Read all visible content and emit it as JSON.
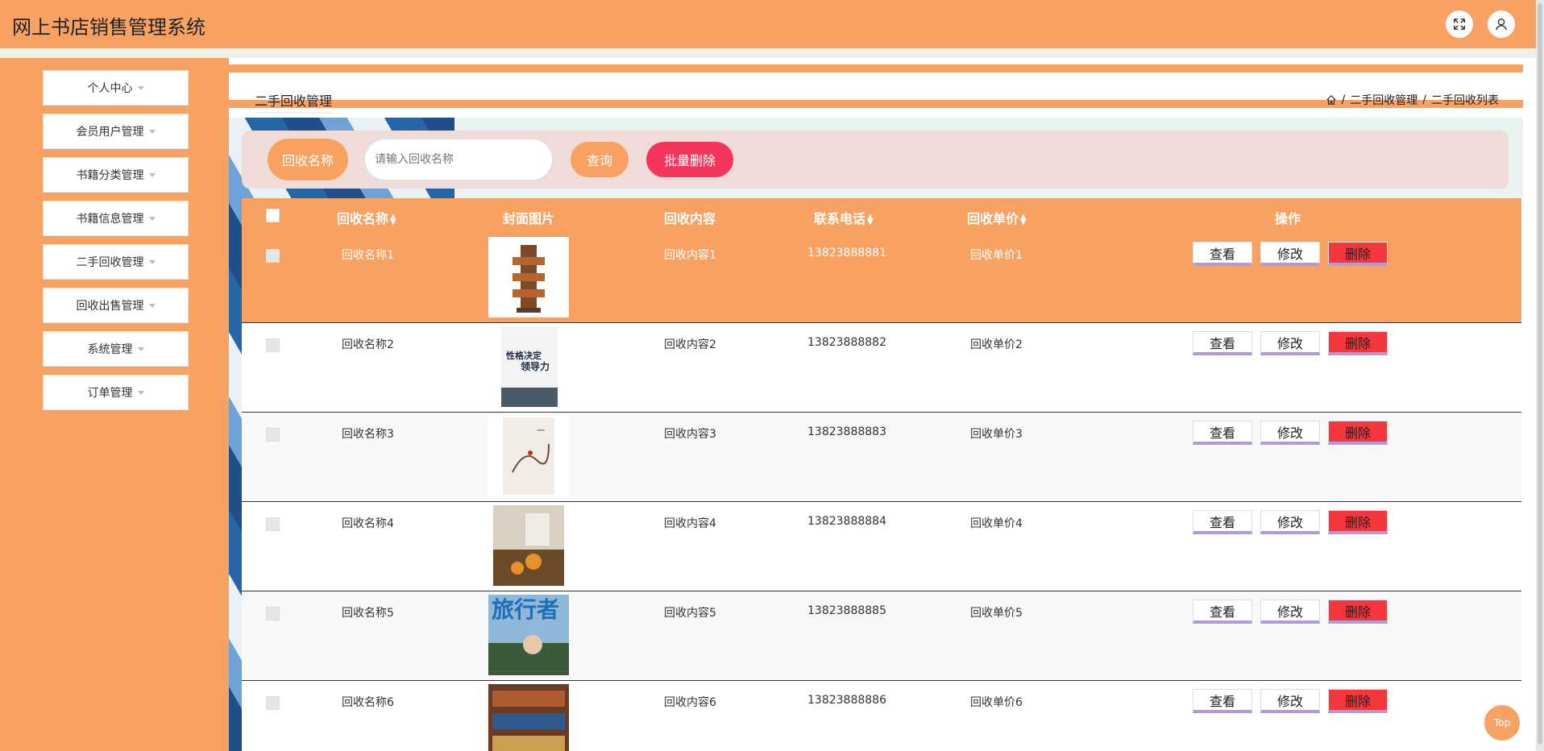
{
  "header": {
    "title": "网上书店销售管理系统",
    "fullscreen_icon": "fullscreen-icon",
    "user_icon": "user-icon"
  },
  "sidebar": {
    "items": [
      {
        "label": "个人中心"
      },
      {
        "label": "会员用户管理"
      },
      {
        "label": "书籍分类管理"
      },
      {
        "label": "书籍信息管理"
      },
      {
        "label": "二手回收管理"
      },
      {
        "label": "回收出售管理"
      },
      {
        "label": "系统管理"
      },
      {
        "label": "订单管理"
      }
    ]
  },
  "breadcrumb": {
    "title": "二手回收管理",
    "home_icon": "home-icon",
    "path1": "二手回收管理",
    "path2": "二手回收列表",
    "sep": "/"
  },
  "search": {
    "label": "回收名称",
    "placeholder": "请输入回收名称",
    "query_label": "查询",
    "bulk_delete_label": "批量删除"
  },
  "table": {
    "headers": {
      "name": "回收名称",
      "cover": "封面图片",
      "content": "回收内容",
      "phone": "联系电话",
      "price": "回收单价",
      "actions": "操作"
    },
    "buttons": {
      "view": "查看",
      "edit": "修改",
      "delete": "删除"
    },
    "rows": [
      {
        "name": "回收名称1",
        "content": "回收内容1",
        "phone": "13823888881",
        "price": "回收单价1"
      },
      {
        "name": "回收名称2",
        "content": "回收内容2",
        "phone": "13823888882",
        "price": "回收单价2"
      },
      {
        "name": "回收名称3",
        "content": "回收内容3",
        "phone": "13823888883",
        "price": "回收单价3"
      },
      {
        "name": "回收名称4",
        "content": "回收内容4",
        "phone": "13823888884",
        "price": "回收单价4"
      },
      {
        "name": "回收名称5",
        "content": "回收内容5",
        "phone": "13823888885",
        "price": "回收单价5"
      },
      {
        "name": "回收名称6",
        "content": "回收内容6",
        "phone": "13823888886",
        "price": "回收单价6"
      }
    ],
    "cover_texts": {
      "book2_title": "性格决定",
      "book2_sub": "领导力",
      "book5_title": "旅行者"
    }
  },
  "top_button": "Top",
  "colors": {
    "accent": "#f7a263",
    "danger": "#f5365c",
    "delete_btn": "#f5363c"
  }
}
